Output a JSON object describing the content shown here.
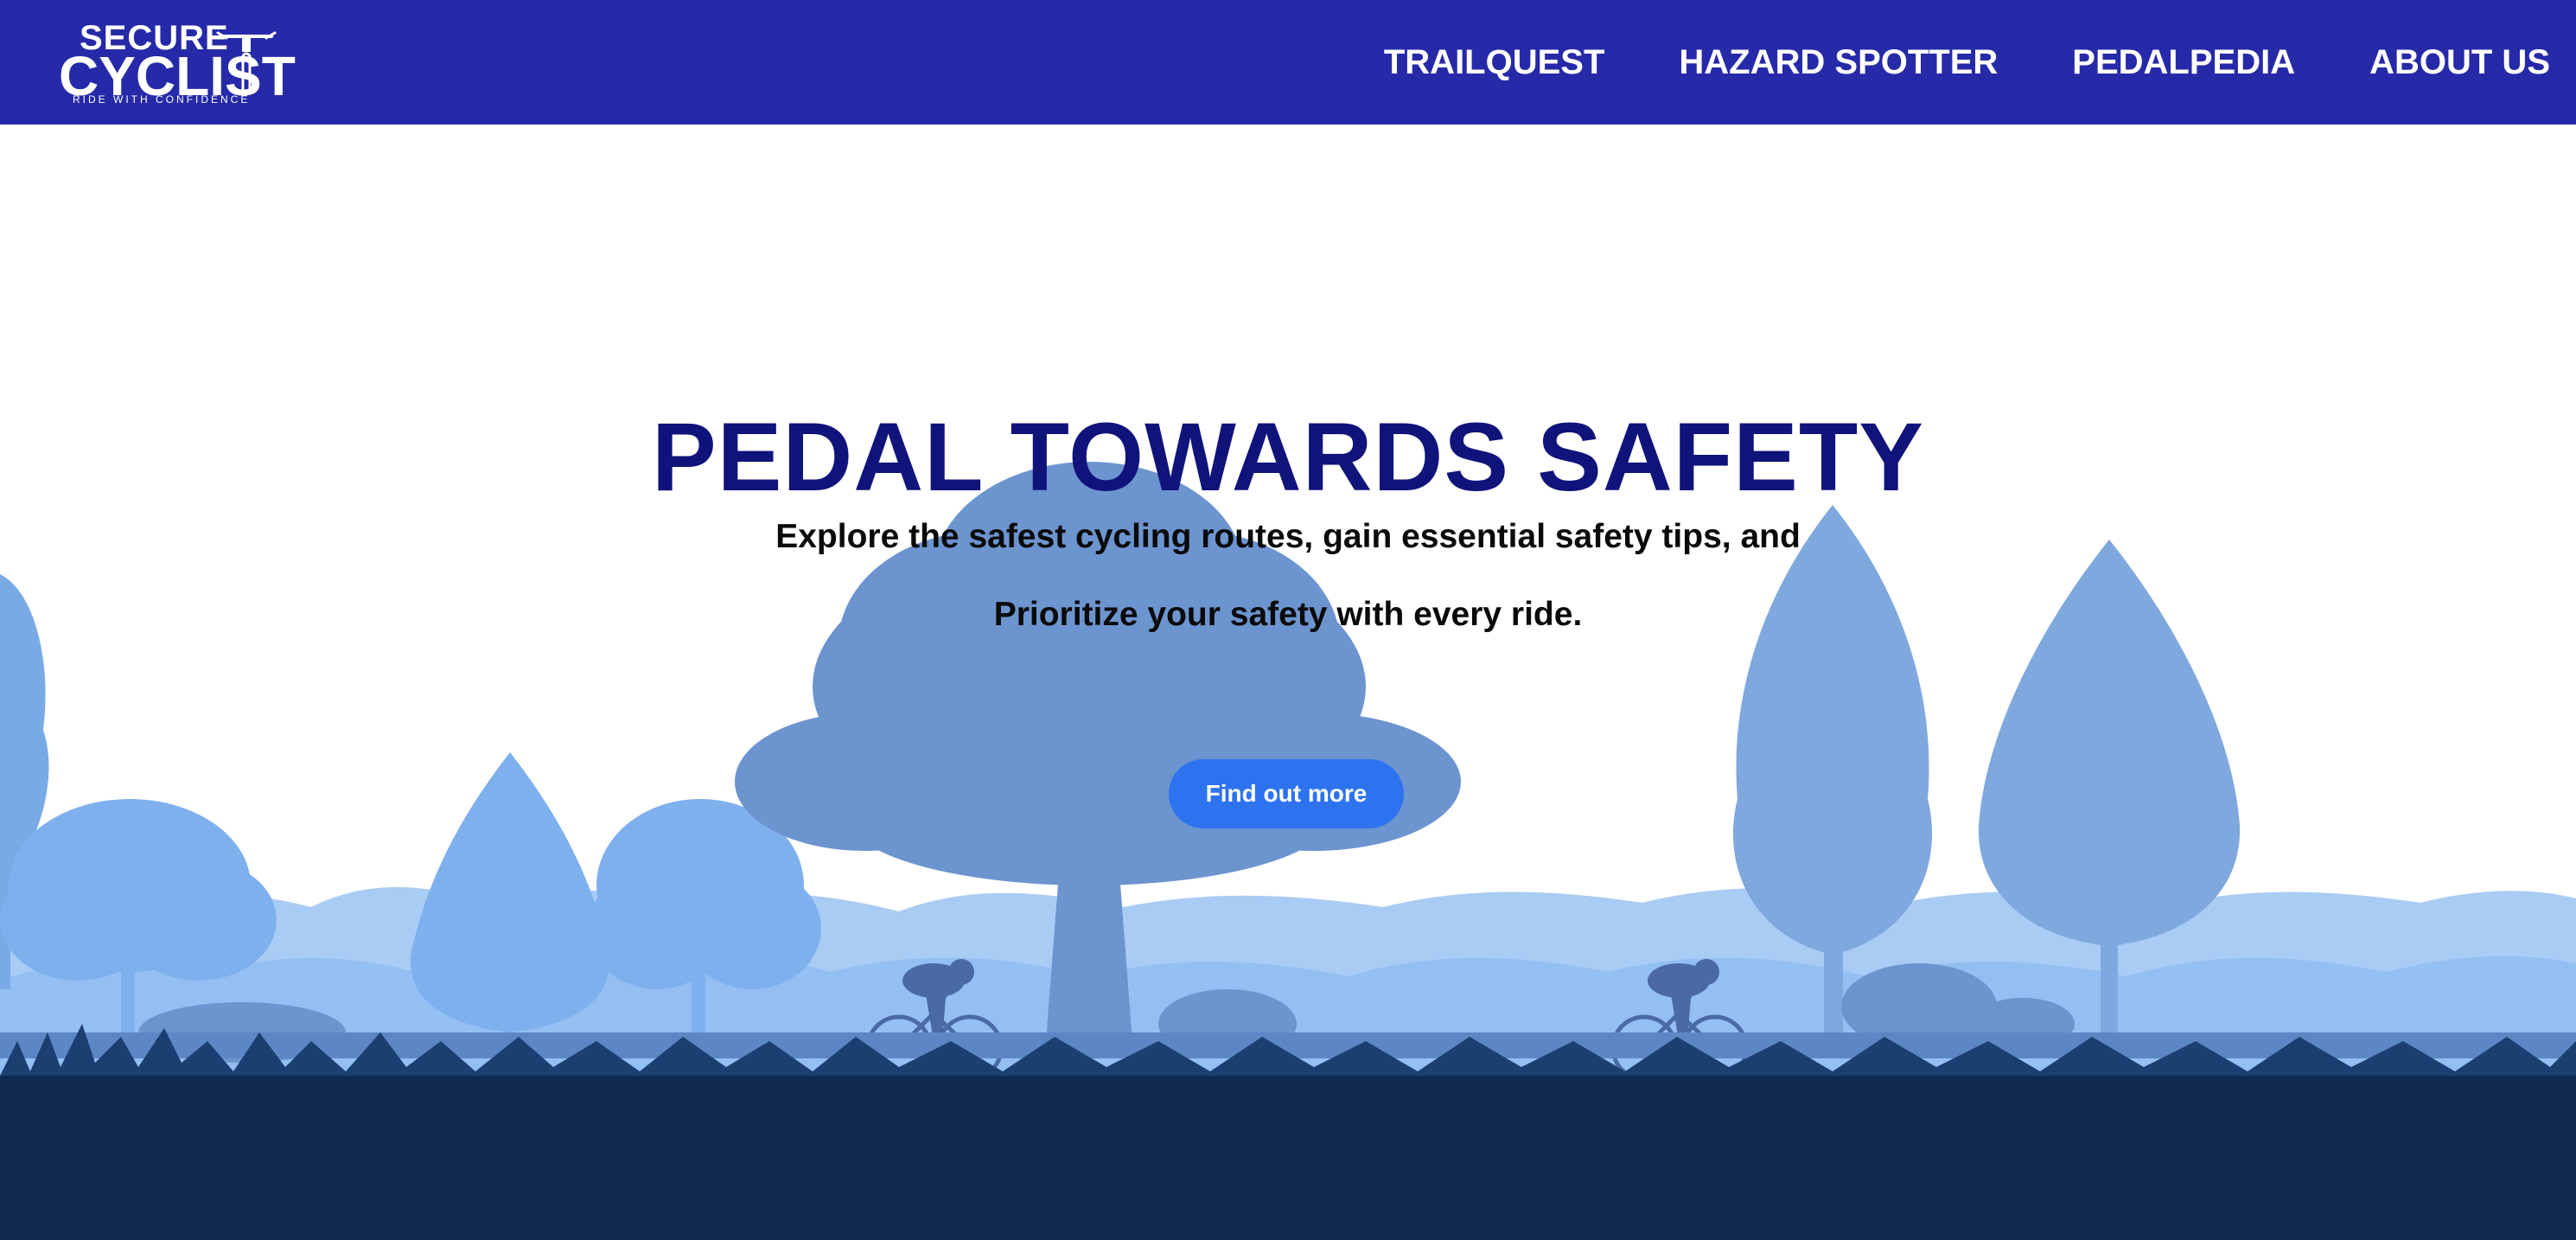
{
  "brand": {
    "line1": "SECURE",
    "line2": "CYCLIST",
    "tagline": "RIDE WITH CONFIDENCE"
  },
  "nav": {
    "items": [
      {
        "label": "TRAILQUEST"
      },
      {
        "label": "HAZARD SPOTTER"
      },
      {
        "label": "PEDALPEDIA"
      },
      {
        "label": "ABOUT US"
      }
    ]
  },
  "hero": {
    "title": "PEDAL TOWARDS SAFETY",
    "subtitle_line1": "Explore the safest cycling routes, gain essential safety tips, and",
    "subtitle_line2": "Prioritize your safety with every ride.",
    "cta_label": "Find out more"
  },
  "colors": {
    "nav_bg": "#262aa8",
    "title": "#10137a",
    "button": "#2d73f0",
    "ground": "#0f2a4e",
    "trees_light": "#9cc4f2",
    "trees_mid": "#7fb0ee",
    "trees_dark": "#6c94cf"
  }
}
